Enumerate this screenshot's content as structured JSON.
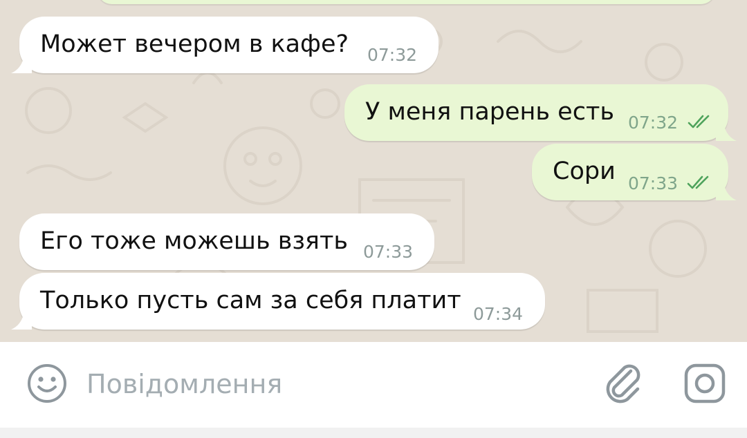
{
  "colors": {
    "wallpaper": "#e5ded4",
    "incoming_bubble": "#ffffff",
    "outgoing_bubble": "#e9f7d4",
    "read_ticks": "#4fa35c",
    "input_icons": "#8e979d"
  },
  "messages": [
    {
      "direction": "incoming",
      "text": "Может вечером в кафе?",
      "time": "07:32"
    },
    {
      "direction": "outgoing",
      "text": "У меня парень есть",
      "time": "07:32",
      "status": "read"
    },
    {
      "direction": "outgoing",
      "text": "Сори",
      "time": "07:33",
      "status": "read"
    },
    {
      "direction": "incoming",
      "text": "Его тоже можешь взять",
      "time": "07:33"
    },
    {
      "direction": "incoming",
      "text": "Только пусть сам за себя платит",
      "time": "07:34"
    }
  ],
  "composer": {
    "placeholder": "Повідомлення",
    "value": "",
    "emoji_icon": "smiley-face-icon",
    "attach_icon": "paperclip-icon",
    "camera_icon": "camera-icon"
  }
}
